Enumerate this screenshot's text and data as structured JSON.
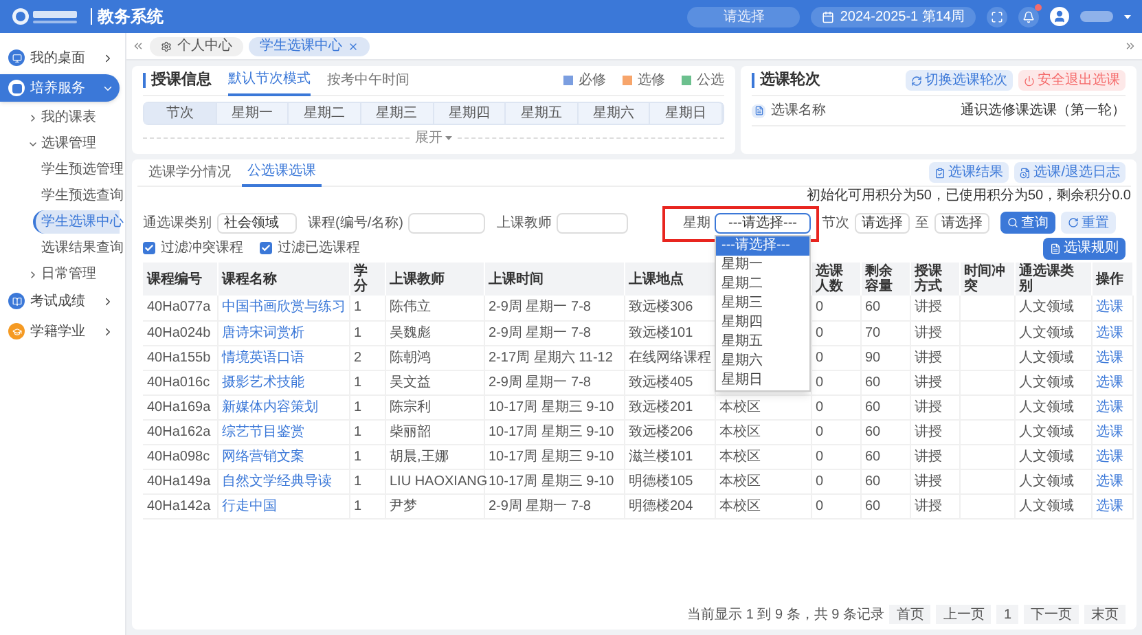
{
  "header": {
    "system_name": "教务系统",
    "search": {
      "placeholder": "请选择"
    },
    "term": "2024-2025-1 第14周",
    "has_notification": true
  },
  "sidebar": {
    "items": [
      {
        "label": "我的桌面",
        "selected": false,
        "expanded": false,
        "color": "#3b78d8"
      },
      {
        "label": "培养服务",
        "selected": true,
        "expanded": true,
        "color": "#3b78d8",
        "children": [
          {
            "label": "我的课表",
            "selected": false,
            "expanded": false
          },
          {
            "label": "选课管理",
            "selected": false,
            "expanded": true,
            "children": [
              {
                "label": "学生预选管理",
                "selected": false
              },
              {
                "label": "学生预选查询",
                "selected": false
              },
              {
                "label": "学生选课中心",
                "selected": true
              },
              {
                "label": "选课结果查询",
                "selected": false
              }
            ]
          },
          {
            "label": "日常管理",
            "selected": false,
            "expanded": false
          }
        ]
      },
      {
        "label": "考试成绩",
        "selected": false,
        "expanded": false,
        "color": "#3b78d8"
      },
      {
        "label": "学籍学业",
        "selected": false,
        "expanded": false,
        "color": "#f59a23"
      }
    ]
  },
  "tabs_bar": {
    "tabs": [
      {
        "label": "个人中心",
        "selected": false,
        "closable": false
      },
      {
        "label": "学生选课中心",
        "selected": true,
        "closable": true
      }
    ]
  },
  "teaching_info": {
    "title": "授课信息",
    "modes": [
      {
        "label": "默认节次模式",
        "selected": true
      },
      {
        "label": "按考中午时间",
        "selected": false
      }
    ],
    "legend": [
      {
        "label": "必修",
        "color": "#7b9ee0"
      },
      {
        "label": "选修",
        "color": "#f7a56b"
      },
      {
        "label": "公选",
        "color": "#6cc08e"
      }
    ],
    "columns": [
      "节次",
      "星期一",
      "星期二",
      "星期三",
      "星期四",
      "星期五",
      "星期六",
      "星期日"
    ],
    "expand_label": "展开"
  },
  "round": {
    "title": "选课轮次",
    "buttons": [
      {
        "label": "切换选课轮次",
        "kind": "primary"
      },
      {
        "label": "安全退出选课",
        "kind": "danger"
      }
    ],
    "name_label": "选课名称",
    "name_value": "通识选修课选课（第一轮）"
  },
  "selection": {
    "tabs": [
      {
        "label": "选课学分情况",
        "selected": false
      },
      {
        "label": "公选课选课",
        "selected": true
      }
    ],
    "actions": [
      "选课结果",
      "选课/退选日志"
    ],
    "credit_note": "初始化可用积分为50，已使用积分为50，剩余积分0.0",
    "filters": {
      "category": {
        "label": "通选课类别",
        "value": "社会领域"
      },
      "course": {
        "label": "课程(编号/名称)"
      },
      "teacher": {
        "label": "上课教师"
      },
      "weekday": {
        "label": "星期",
        "value": "---请选择---",
        "highlighted": true,
        "open": true,
        "options": [
          {
            "label": "---请选择---",
            "selected": true
          },
          {
            "label": "星期一",
            "selected": false
          },
          {
            "label": "星期二",
            "selected": false
          },
          {
            "label": "星期三",
            "selected": false
          },
          {
            "label": "星期四",
            "selected": false
          },
          {
            "label": "星期五",
            "selected": false
          },
          {
            "label": "星期六",
            "selected": false
          },
          {
            "label": "星期日",
            "selected": false
          }
        ]
      },
      "period": {
        "label": "节次",
        "from": "请选择",
        "to_label": "至",
        "to": "请选择"
      }
    },
    "search_button": "查询",
    "reset_button": "重置",
    "rules_button": "选课规则",
    "checkboxes": [
      {
        "label": "过滤冲突课程",
        "checked": true
      },
      {
        "label": "过滤已选课程",
        "checked": true
      }
    ],
    "table": {
      "columns": [
        {
          "label": "课程编号",
          "kind": "text"
        },
        {
          "label": "课程名称",
          "kind": "link"
        },
        {
          "label": "学分",
          "kind": "text"
        },
        {
          "label": "上课教师",
          "kind": "text"
        },
        {
          "label": "上课时间",
          "kind": "text"
        },
        {
          "label": "上课地点",
          "kind": "text"
        },
        {
          "kind": "text"
        },
        {
          "label": "选课人数",
          "kind": "text"
        },
        {
          "label": "剩余容量",
          "kind": "text"
        },
        {
          "label": "授课方式",
          "kind": "text"
        },
        {
          "label": "时间冲突",
          "kind": "text"
        },
        {
          "label": "通选课类别",
          "kind": "text"
        },
        {
          "label": "操作",
          "kind": "link"
        }
      ],
      "rows": [
        [
          "40Ha077a",
          "中国书画欣赏与练习",
          "1",
          "陈伟立",
          "2-9周 星期一 7-8",
          "致远楼306",
          null,
          "0",
          "60",
          "讲授",
          null,
          "人文领域",
          "选课"
        ],
        [
          "40Ha024b",
          "唐诗宋词赏析",
          "1",
          "吴魏彪",
          "2-9周 星期一 7-8",
          "致远楼101",
          null,
          "0",
          "70",
          "讲授",
          null,
          "人文领域",
          "选课"
        ],
        [
          "40Ha155b",
          "情境英语口语",
          "2",
          "陈朝鸿",
          "2-17周 星期六 11-12",
          "在线网络课程",
          null,
          "0",
          "90",
          "讲授",
          null,
          "人文领域",
          "选课"
        ],
        [
          "40Ha016c",
          "摄影艺术技能",
          "1",
          "吴文益",
          "2-9周 星期一 7-8",
          "致远楼405",
          null,
          "0",
          "60",
          "讲授",
          null,
          "人文领域",
          "选课"
        ],
        [
          "40Ha169a",
          "新媒体内容策划",
          "1",
          "陈宗利",
          "10-17周 星期三 9-10",
          "致远楼201",
          "本校区",
          "0",
          "60",
          "讲授",
          null,
          "人文领域",
          "选课"
        ],
        [
          "40Ha162a",
          "综艺节目鉴赏",
          "1",
          "柴丽韶",
          "10-17周 星期三 9-10",
          "致远楼206",
          "本校区",
          "0",
          "60",
          "讲授",
          null,
          "人文领域",
          "选课"
        ],
        [
          "40Ha098c",
          "网络营销文案",
          "1",
          "胡晨,王娜",
          "10-17周 星期三 9-10",
          "滋兰楼101",
          "本校区",
          "0",
          "60",
          "讲授",
          null,
          "人文领域",
          "选课"
        ],
        [
          "40Ha149a",
          "自然文学经典导读",
          "1",
          "LIU HAOXIANG",
          "10-17周 星期三 9-10",
          "明德楼105",
          "本校区",
          "0",
          "60",
          "讲授",
          null,
          "人文领域",
          "选课"
        ],
        [
          "40Ha142a",
          "行走中国",
          "1",
          "尹梦",
          "2-9周 星期一 7-8",
          "明德楼204",
          "本校区",
          "0",
          "60",
          "讲授",
          null,
          "人文领域",
          "选课"
        ]
      ]
    },
    "pager": {
      "summary": "当前显示 1 到 9 条，共 9 条记录",
      "buttons": [
        "首页",
        "上一页",
        "1",
        "下一页",
        "末页"
      ]
    }
  }
}
